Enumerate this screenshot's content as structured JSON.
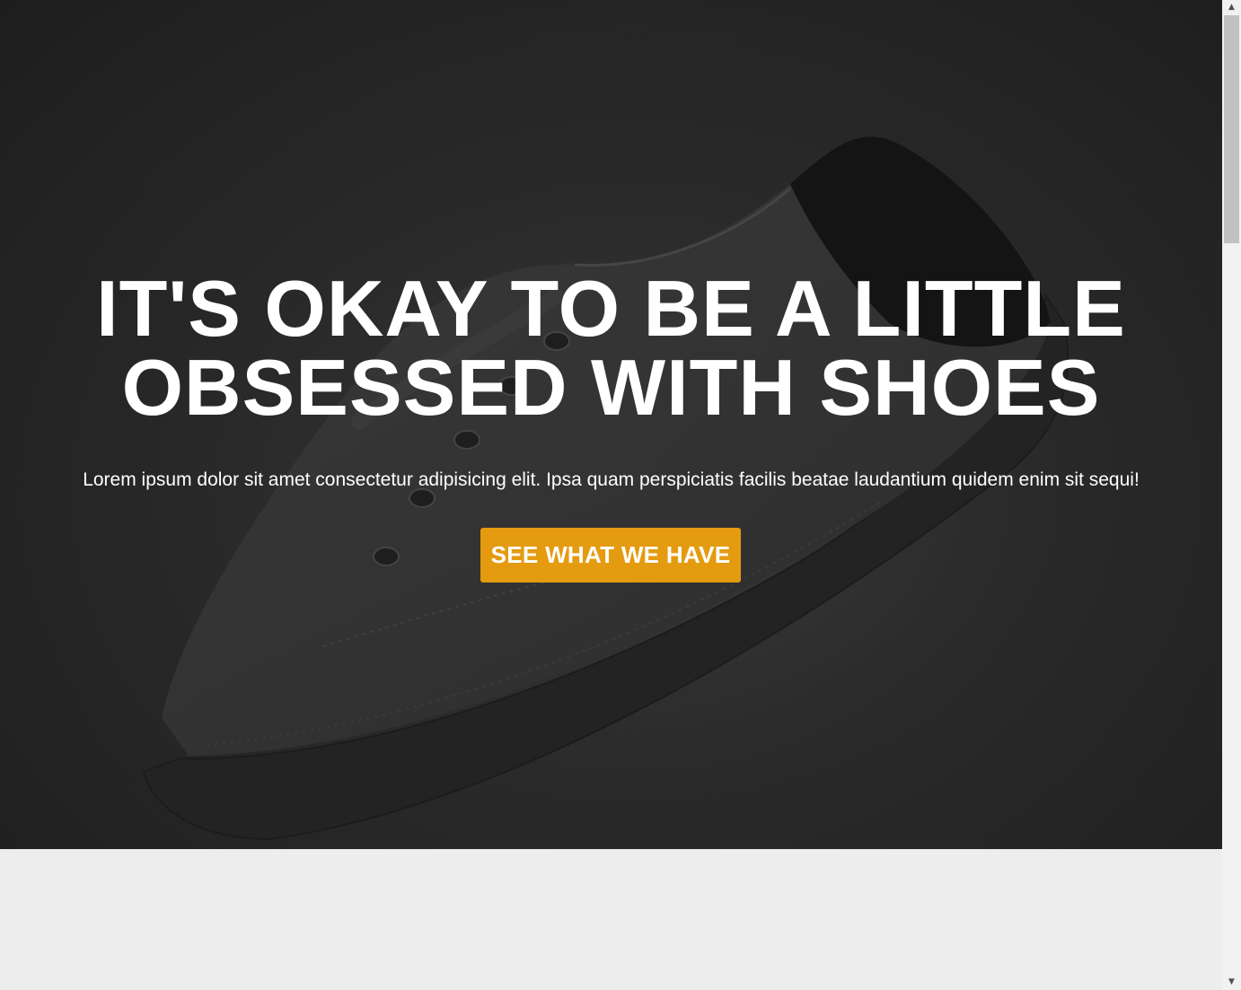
{
  "hero": {
    "title_line_1": "IT'S OKAY TO BE A LITTLE",
    "title_line_2": "OBSESSED WITH SHOES",
    "text": "Lorem ipsum dolor sit amet consectetur adipisicing elit. Ipsa quam perspiciatis facilis beatae laudantium quidem enim sit sequi!",
    "cta_label": "SEE WHAT WE HAVE",
    "background_image": "sneaker-photo",
    "accent_color": "#e49b0f"
  },
  "next_section": {
    "heading_partial": ""
  },
  "scrollbar": {
    "up_icon": "arrow-up-icon",
    "down_icon": "arrow-down-icon"
  }
}
